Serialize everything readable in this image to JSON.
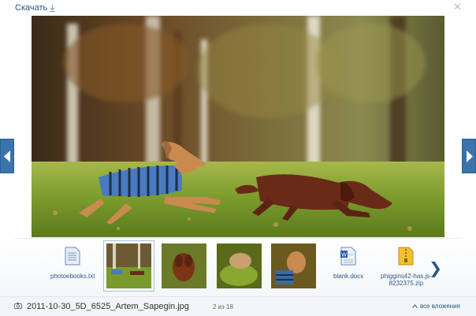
{
  "toolbar": {
    "download_label": "Скачать",
    "download_icon": "download-arrow-icon",
    "close_icon": "close-x-icon"
  },
  "viewer": {
    "prev_icon": "chevron-left-icon",
    "next_icon": "chevron-right-icon"
  },
  "attachments": [
    {
      "name": "photoebooks.txt",
      "kind": "txt",
      "icon": "text-file-icon"
    },
    {
      "name": "",
      "kind": "photo",
      "selected": true
    },
    {
      "name": "",
      "kind": "photo"
    },
    {
      "name": "",
      "kind": "photo"
    },
    {
      "name": "",
      "kind": "photo"
    },
    {
      "name": "blank.docx",
      "kind": "docx",
      "icon": "word-file-icon"
    },
    {
      "name": "phiggins42-has.js-8232375.zip",
      "kind": "zip",
      "icon": "zip-archive-icon"
    }
  ],
  "attachment_labels": {
    "txt": "photoebooks.txt",
    "docx": "blank.docx",
    "zip_line1": "phiggins42-has.js-",
    "zip_line2": "8232375.zip"
  },
  "footer": {
    "file_name": "2011-10-30_5D_6525_Artem_Sapegin.jpg",
    "counter": "2 из 18",
    "all_attachments_label": "все вложения",
    "camera_icon": "camera-icon",
    "chevron_up_icon": "chevron-up-icon"
  },
  "colors": {
    "link": "#2a5885",
    "nav_button": "#3a74ad"
  }
}
